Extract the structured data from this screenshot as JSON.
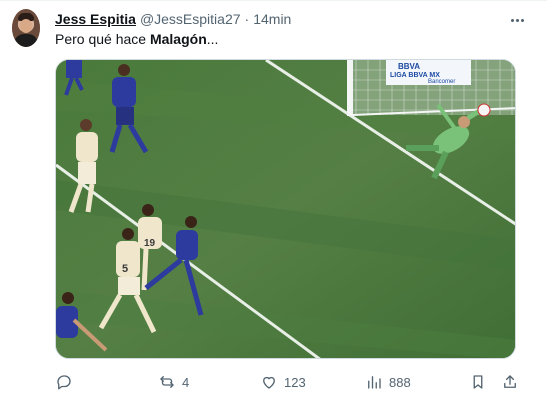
{
  "tweet": {
    "author_name": "Jess Espitia",
    "author_handle": "@JessEspitia27",
    "separator": "·",
    "time": "14min",
    "text_prefix": "Pero qué hace ",
    "text_bold": "Malagón",
    "text_suffix": "...",
    "media_ad_lines": [
      "BBVA",
      "LIGA BBVA MX",
      "Bancomer"
    ],
    "player_numbers": [
      "19",
      "5"
    ]
  },
  "actions": {
    "replies": "",
    "retweets": "4",
    "likes": "123",
    "views": "888"
  },
  "icons": {
    "more": "more-horizontal-icon",
    "reply": "reply-icon",
    "retweet": "retweet-icon",
    "like": "heart-icon",
    "views": "views-icon",
    "bookmark": "bookmark-icon",
    "share": "share-icon"
  }
}
